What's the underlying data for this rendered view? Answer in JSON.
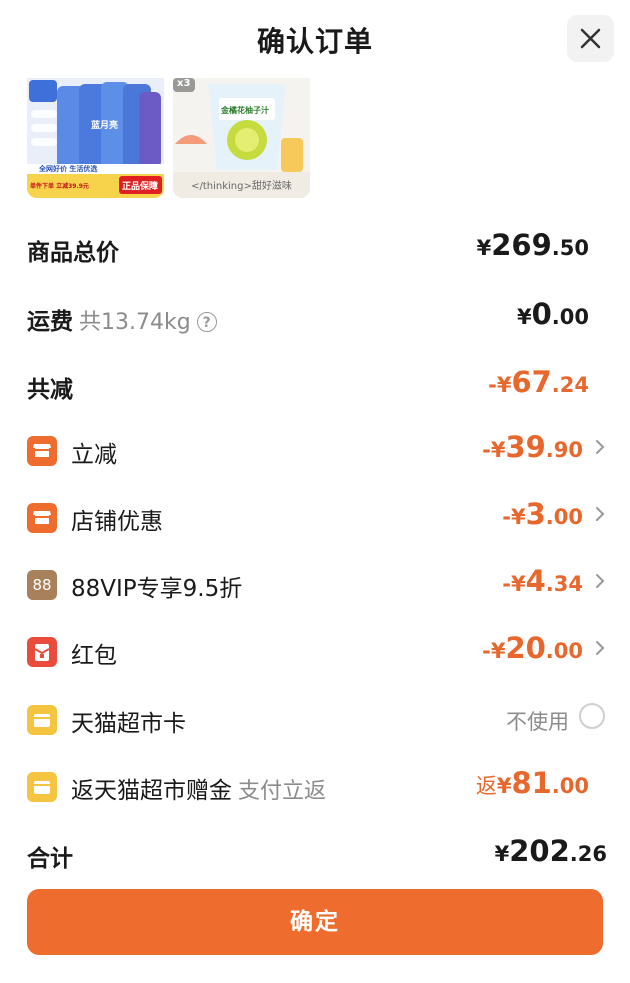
{
  "header": {
    "title": "确认订单"
  },
  "thumbnails": {
    "item1": {
      "brand": "蓝月亮",
      "tagline": "全网好价 生活优选",
      "promo": "单件下单 立减39.9元",
      "guarantee": "正品保障"
    },
    "item2": {
      "quantity": "x3",
      "name": "金橘花柚子汁",
      "caption": "</thinking>甜好滋味"
    }
  },
  "summary": {
    "goods_total": {
      "label": "商品总价",
      "symbol": "¥",
      "int": "269",
      "dec": ".50"
    },
    "shipping": {
      "label": "运费",
      "weight": "共13.74kg",
      "symbol": "¥",
      "int": "0",
      "dec": ".00"
    },
    "total_discount": {
      "label": "共减",
      "symbol": "-¥",
      "int": "67",
      "dec": ".24"
    }
  },
  "discounts": [
    {
      "label": "立减",
      "icon": "store-icon",
      "symbol": "-¥",
      "int": "39",
      "dec": ".90"
    },
    {
      "label": "店铺优惠",
      "icon": "store-icon",
      "symbol": "-¥",
      "int": "3",
      "dec": ".00"
    },
    {
      "label": "88VIP专享9.5折",
      "icon": "88vip-icon",
      "badge_text": "88",
      "symbol": "-¥",
      "int": "4",
      "dec": ".34"
    },
    {
      "label": "红包",
      "icon": "red-envelope-icon",
      "symbol": "-¥",
      "int": "20",
      "dec": ".00"
    }
  ],
  "tmall_card": {
    "label": "天猫超市卡",
    "status": "不使用"
  },
  "rebate": {
    "label": "返天猫超市赠金",
    "note": "支付立返",
    "prefix": "返",
    "symbol": "¥",
    "int": "81",
    "dec": ".00"
  },
  "total": {
    "label": "合计",
    "symbol": "¥",
    "int": "202",
    "dec": ".26"
  },
  "confirm": {
    "label": "确定"
  },
  "colors": {
    "accent": "#ee6d2e",
    "discount_text": "#e8672c",
    "card_yellow": "#f5c542",
    "vip_brown": "#a8805a",
    "red_envelope": "#e94b3c"
  }
}
